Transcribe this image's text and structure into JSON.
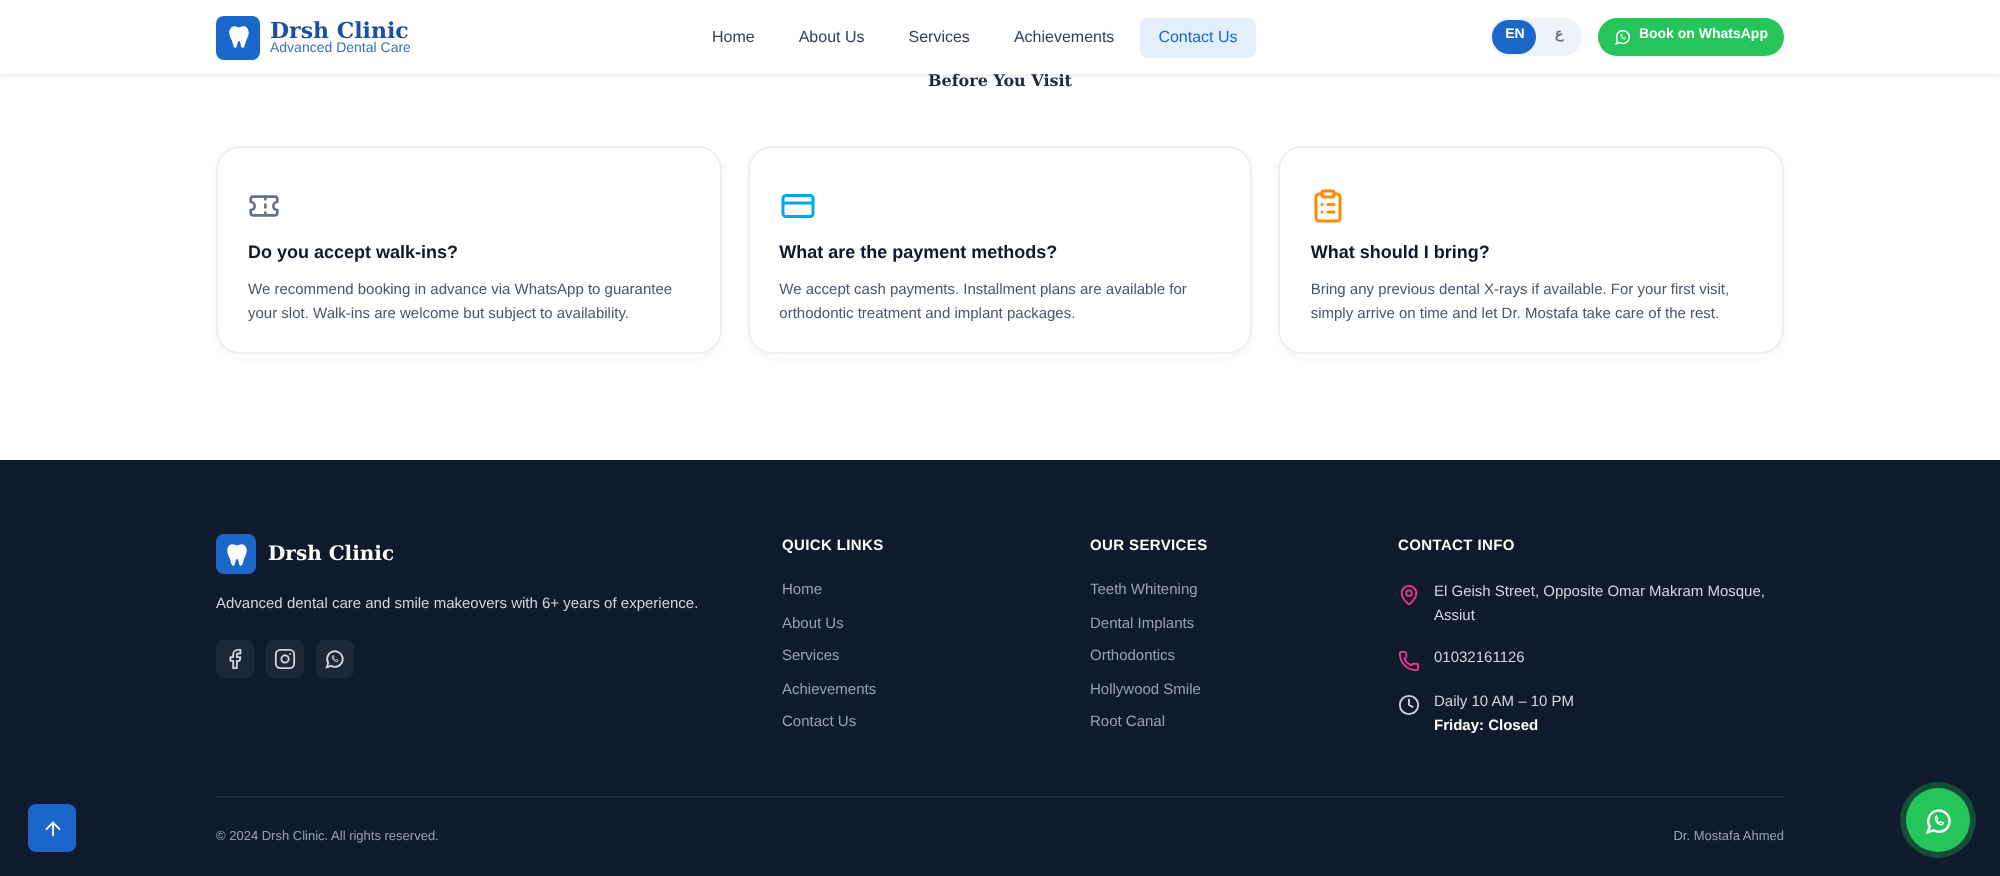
{
  "header": {
    "logo_title": "Drsh Clinic",
    "logo_subtitle": "Advanced Dental Care",
    "nav": [
      {
        "label": "Home",
        "selected": false
      },
      {
        "label": "About Us",
        "selected": false
      },
      {
        "label": "Services",
        "selected": false
      },
      {
        "label": "Achievements",
        "selected": false
      },
      {
        "label": "Contact Us",
        "selected": true
      }
    ],
    "languages": [
      {
        "label": "EN",
        "selected": true
      },
      {
        "label": "ع",
        "selected": false
      }
    ],
    "cta": "Book on WhatsApp"
  },
  "section_heading": "Before You Visit",
  "faq_cards": [
    {
      "kind": "ticket",
      "question": "Do you accept walk-ins?",
      "answer": "We recommend booking in advance via WhatsApp to guarantee your slot. Walk-ins are welcome but subject to availability."
    },
    {
      "kind": "card",
      "question": "What are the payment methods?",
      "answer": "We accept cash payments. Installment plans are available for orthodontic treatment and implant packages."
    },
    {
      "kind": "clipboard",
      "question": "What should I bring?",
      "answer": "Bring any previous dental X-rays if available. For your first visit, simply arrive on time and let Dr. Mostafa take care of the rest."
    }
  ],
  "footer": {
    "brand": "Drsh Clinic",
    "tagline": "Advanced dental care and smile makeovers with 6+ years of experience.",
    "socials": [
      {
        "kind": "facebook"
      },
      {
        "kind": "instagram"
      },
      {
        "kind": "whatsapp"
      }
    ],
    "quick_links": {
      "title": "QUICK LINKS",
      "items": [
        "Home",
        "About Us",
        "Services",
        "Achievements",
        "Contact Us"
      ]
    },
    "services": {
      "title": "OUR SERVICES",
      "items": [
        "Teeth Whitening",
        "Dental Implants",
        "Orthodontics",
        "Hollywood Smile",
        "Root Canal"
      ]
    },
    "contact": {
      "title": "CONTACT INFO",
      "items": [
        {
          "kind": "address",
          "lines": [
            "El Geish Street, Opposite Omar Makram Mosque, Assiut"
          ]
        },
        {
          "kind": "phone",
          "lines": [
            "01032161126"
          ]
        },
        {
          "kind": "hours",
          "lines": [
            "Daily 10 AM – 10 PM",
            "Friday: Closed"
          ]
        }
      ]
    },
    "copyright": "© 2024 Drsh Clinic. All rights reserved.",
    "credit": "Dr. Mostafa Ahmed"
  }
}
